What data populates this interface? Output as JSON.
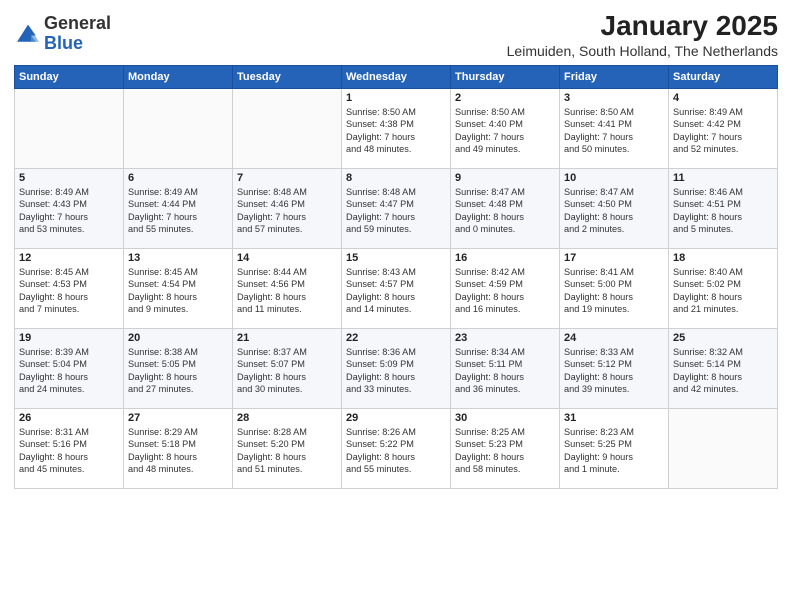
{
  "header": {
    "logo_general": "General",
    "logo_blue": "Blue",
    "month_title": "January 2025",
    "location": "Leimuiden, South Holland, The Netherlands"
  },
  "weekdays": [
    "Sunday",
    "Monday",
    "Tuesday",
    "Wednesday",
    "Thursday",
    "Friday",
    "Saturday"
  ],
  "weeks": [
    [
      {
        "day": "",
        "info": ""
      },
      {
        "day": "",
        "info": ""
      },
      {
        "day": "",
        "info": ""
      },
      {
        "day": "1",
        "info": "Sunrise: 8:50 AM\nSunset: 4:38 PM\nDaylight: 7 hours\nand 48 minutes."
      },
      {
        "day": "2",
        "info": "Sunrise: 8:50 AM\nSunset: 4:40 PM\nDaylight: 7 hours\nand 49 minutes."
      },
      {
        "day": "3",
        "info": "Sunrise: 8:50 AM\nSunset: 4:41 PM\nDaylight: 7 hours\nand 50 minutes."
      },
      {
        "day": "4",
        "info": "Sunrise: 8:49 AM\nSunset: 4:42 PM\nDaylight: 7 hours\nand 52 minutes."
      }
    ],
    [
      {
        "day": "5",
        "info": "Sunrise: 8:49 AM\nSunset: 4:43 PM\nDaylight: 7 hours\nand 53 minutes."
      },
      {
        "day": "6",
        "info": "Sunrise: 8:49 AM\nSunset: 4:44 PM\nDaylight: 7 hours\nand 55 minutes."
      },
      {
        "day": "7",
        "info": "Sunrise: 8:48 AM\nSunset: 4:46 PM\nDaylight: 7 hours\nand 57 minutes."
      },
      {
        "day": "8",
        "info": "Sunrise: 8:48 AM\nSunset: 4:47 PM\nDaylight: 7 hours\nand 59 minutes."
      },
      {
        "day": "9",
        "info": "Sunrise: 8:47 AM\nSunset: 4:48 PM\nDaylight: 8 hours\nand 0 minutes."
      },
      {
        "day": "10",
        "info": "Sunrise: 8:47 AM\nSunset: 4:50 PM\nDaylight: 8 hours\nand 2 minutes."
      },
      {
        "day": "11",
        "info": "Sunrise: 8:46 AM\nSunset: 4:51 PM\nDaylight: 8 hours\nand 5 minutes."
      }
    ],
    [
      {
        "day": "12",
        "info": "Sunrise: 8:45 AM\nSunset: 4:53 PM\nDaylight: 8 hours\nand 7 minutes."
      },
      {
        "day": "13",
        "info": "Sunrise: 8:45 AM\nSunset: 4:54 PM\nDaylight: 8 hours\nand 9 minutes."
      },
      {
        "day": "14",
        "info": "Sunrise: 8:44 AM\nSunset: 4:56 PM\nDaylight: 8 hours\nand 11 minutes."
      },
      {
        "day": "15",
        "info": "Sunrise: 8:43 AM\nSunset: 4:57 PM\nDaylight: 8 hours\nand 14 minutes."
      },
      {
        "day": "16",
        "info": "Sunrise: 8:42 AM\nSunset: 4:59 PM\nDaylight: 8 hours\nand 16 minutes."
      },
      {
        "day": "17",
        "info": "Sunrise: 8:41 AM\nSunset: 5:00 PM\nDaylight: 8 hours\nand 19 minutes."
      },
      {
        "day": "18",
        "info": "Sunrise: 8:40 AM\nSunset: 5:02 PM\nDaylight: 8 hours\nand 21 minutes."
      }
    ],
    [
      {
        "day": "19",
        "info": "Sunrise: 8:39 AM\nSunset: 5:04 PM\nDaylight: 8 hours\nand 24 minutes."
      },
      {
        "day": "20",
        "info": "Sunrise: 8:38 AM\nSunset: 5:05 PM\nDaylight: 8 hours\nand 27 minutes."
      },
      {
        "day": "21",
        "info": "Sunrise: 8:37 AM\nSunset: 5:07 PM\nDaylight: 8 hours\nand 30 minutes."
      },
      {
        "day": "22",
        "info": "Sunrise: 8:36 AM\nSunset: 5:09 PM\nDaylight: 8 hours\nand 33 minutes."
      },
      {
        "day": "23",
        "info": "Sunrise: 8:34 AM\nSunset: 5:11 PM\nDaylight: 8 hours\nand 36 minutes."
      },
      {
        "day": "24",
        "info": "Sunrise: 8:33 AM\nSunset: 5:12 PM\nDaylight: 8 hours\nand 39 minutes."
      },
      {
        "day": "25",
        "info": "Sunrise: 8:32 AM\nSunset: 5:14 PM\nDaylight: 8 hours\nand 42 minutes."
      }
    ],
    [
      {
        "day": "26",
        "info": "Sunrise: 8:31 AM\nSunset: 5:16 PM\nDaylight: 8 hours\nand 45 minutes."
      },
      {
        "day": "27",
        "info": "Sunrise: 8:29 AM\nSunset: 5:18 PM\nDaylight: 8 hours\nand 48 minutes."
      },
      {
        "day": "28",
        "info": "Sunrise: 8:28 AM\nSunset: 5:20 PM\nDaylight: 8 hours\nand 51 minutes."
      },
      {
        "day": "29",
        "info": "Sunrise: 8:26 AM\nSunset: 5:22 PM\nDaylight: 8 hours\nand 55 minutes."
      },
      {
        "day": "30",
        "info": "Sunrise: 8:25 AM\nSunset: 5:23 PM\nDaylight: 8 hours\nand 58 minutes."
      },
      {
        "day": "31",
        "info": "Sunrise: 8:23 AM\nSunset: 5:25 PM\nDaylight: 9 hours\nand 1 minute."
      },
      {
        "day": "",
        "info": ""
      }
    ]
  ]
}
